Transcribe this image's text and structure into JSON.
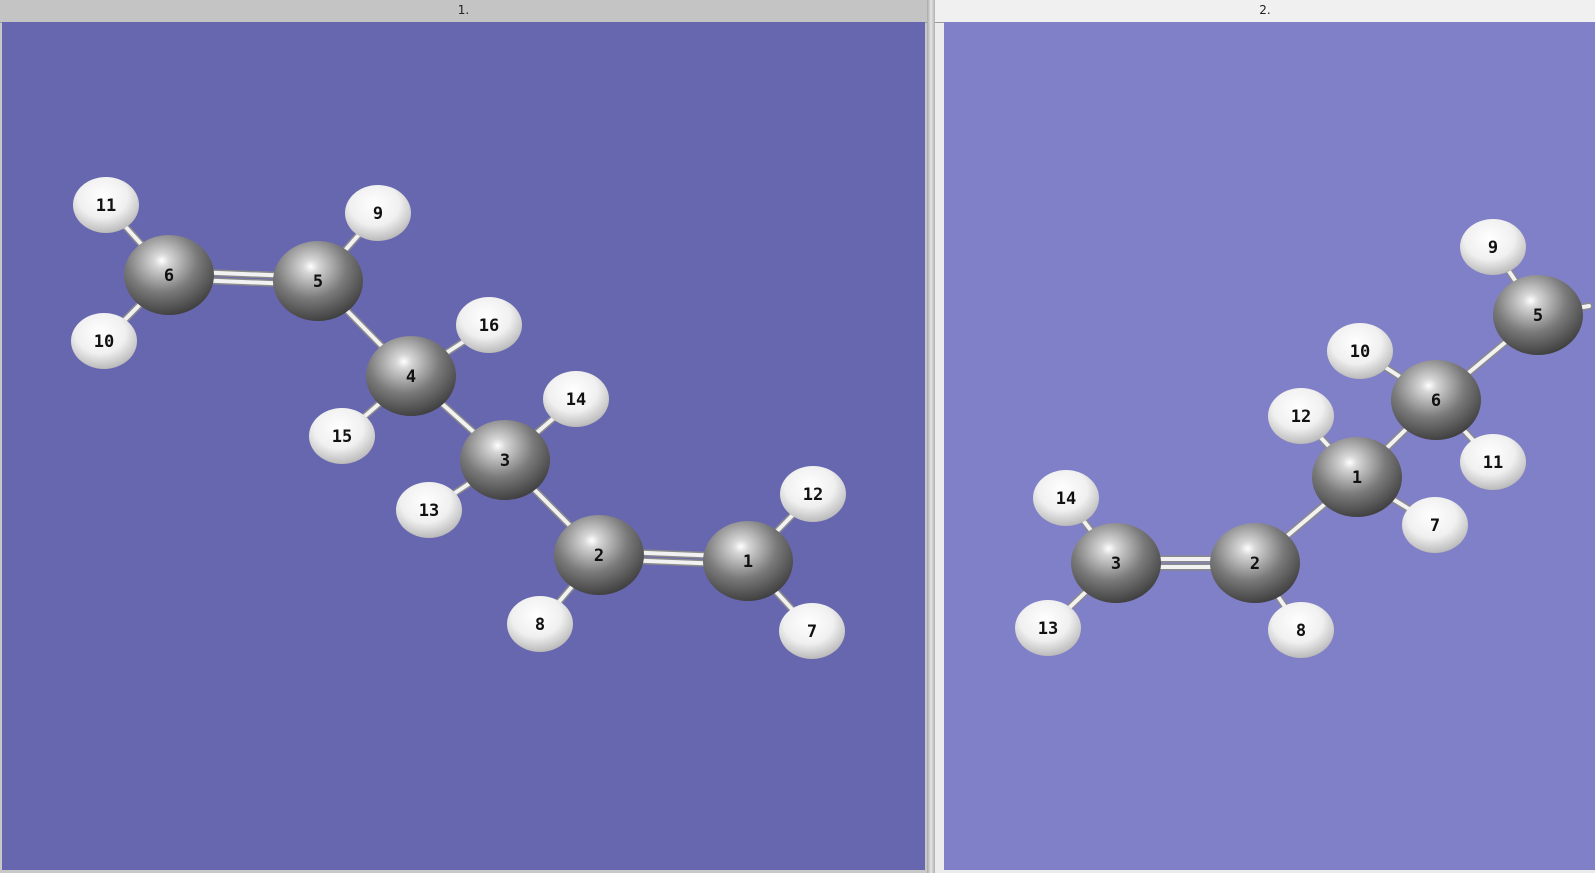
{
  "windows": [
    {
      "title": "1.",
      "background": "#6767b0",
      "atoms": [
        {
          "id": "1",
          "el": "C"
        },
        {
          "id": "2",
          "el": "C"
        },
        {
          "id": "3",
          "el": "C"
        },
        {
          "id": "4",
          "el": "C"
        },
        {
          "id": "5",
          "el": "C"
        },
        {
          "id": "6",
          "el": "C"
        },
        {
          "id": "7",
          "el": "H"
        },
        {
          "id": "8",
          "el": "H"
        },
        {
          "id": "9",
          "el": "H"
        },
        {
          "id": "10",
          "el": "H"
        },
        {
          "id": "11",
          "el": "H"
        },
        {
          "id": "12",
          "el": "H"
        },
        {
          "id": "13",
          "el": "H"
        },
        {
          "id": "14",
          "el": "H"
        },
        {
          "id": "15",
          "el": "H"
        },
        {
          "id": "16",
          "el": "H"
        }
      ],
      "bonds": [
        [
          "11",
          "6",
          1
        ],
        [
          "10",
          "6",
          1
        ],
        [
          "6",
          "5",
          2
        ],
        [
          "9",
          "5",
          1
        ],
        [
          "5",
          "4",
          1
        ],
        [
          "16",
          "4",
          1
        ],
        [
          "15",
          "4",
          1
        ],
        [
          "4",
          "3",
          1
        ],
        [
          "14",
          "3",
          1
        ],
        [
          "13",
          "3",
          1
        ],
        [
          "3",
          "2",
          1
        ],
        [
          "8",
          "2",
          1
        ],
        [
          "2",
          "1",
          2
        ],
        [
          "12",
          "1",
          1
        ],
        [
          "7",
          "1",
          1
        ]
      ]
    },
    {
      "title": "2.",
      "background": "#8080c8",
      "atoms": [
        {
          "id": "1",
          "el": "C"
        },
        {
          "id": "2",
          "el": "C"
        },
        {
          "id": "3",
          "el": "C"
        },
        {
          "id": "5",
          "el": "C"
        },
        {
          "id": "6",
          "el": "C"
        },
        {
          "id": "7",
          "el": "H"
        },
        {
          "id": "8",
          "el": "H"
        },
        {
          "id": "9",
          "el": "H"
        },
        {
          "id": "10",
          "el": "H"
        },
        {
          "id": "11",
          "el": "H"
        },
        {
          "id": "12",
          "el": "H"
        },
        {
          "id": "13",
          "el": "H"
        },
        {
          "id": "14",
          "el": "H"
        }
      ],
      "bonds": [
        [
          "14",
          "3",
          1
        ],
        [
          "13",
          "3",
          1
        ],
        [
          "3",
          "2",
          2
        ],
        [
          "8",
          "2",
          1
        ],
        [
          "2",
          "1",
          1
        ],
        [
          "12",
          "1",
          1
        ],
        [
          "7",
          "1",
          1
        ],
        [
          "1",
          "6",
          1
        ],
        [
          "10",
          "6",
          1
        ],
        [
          "11",
          "6",
          1
        ],
        [
          "6",
          "5",
          1
        ],
        [
          "9",
          "5",
          1
        ],
        [
          "5",
          "edge",
          1
        ]
      ]
    }
  ]
}
